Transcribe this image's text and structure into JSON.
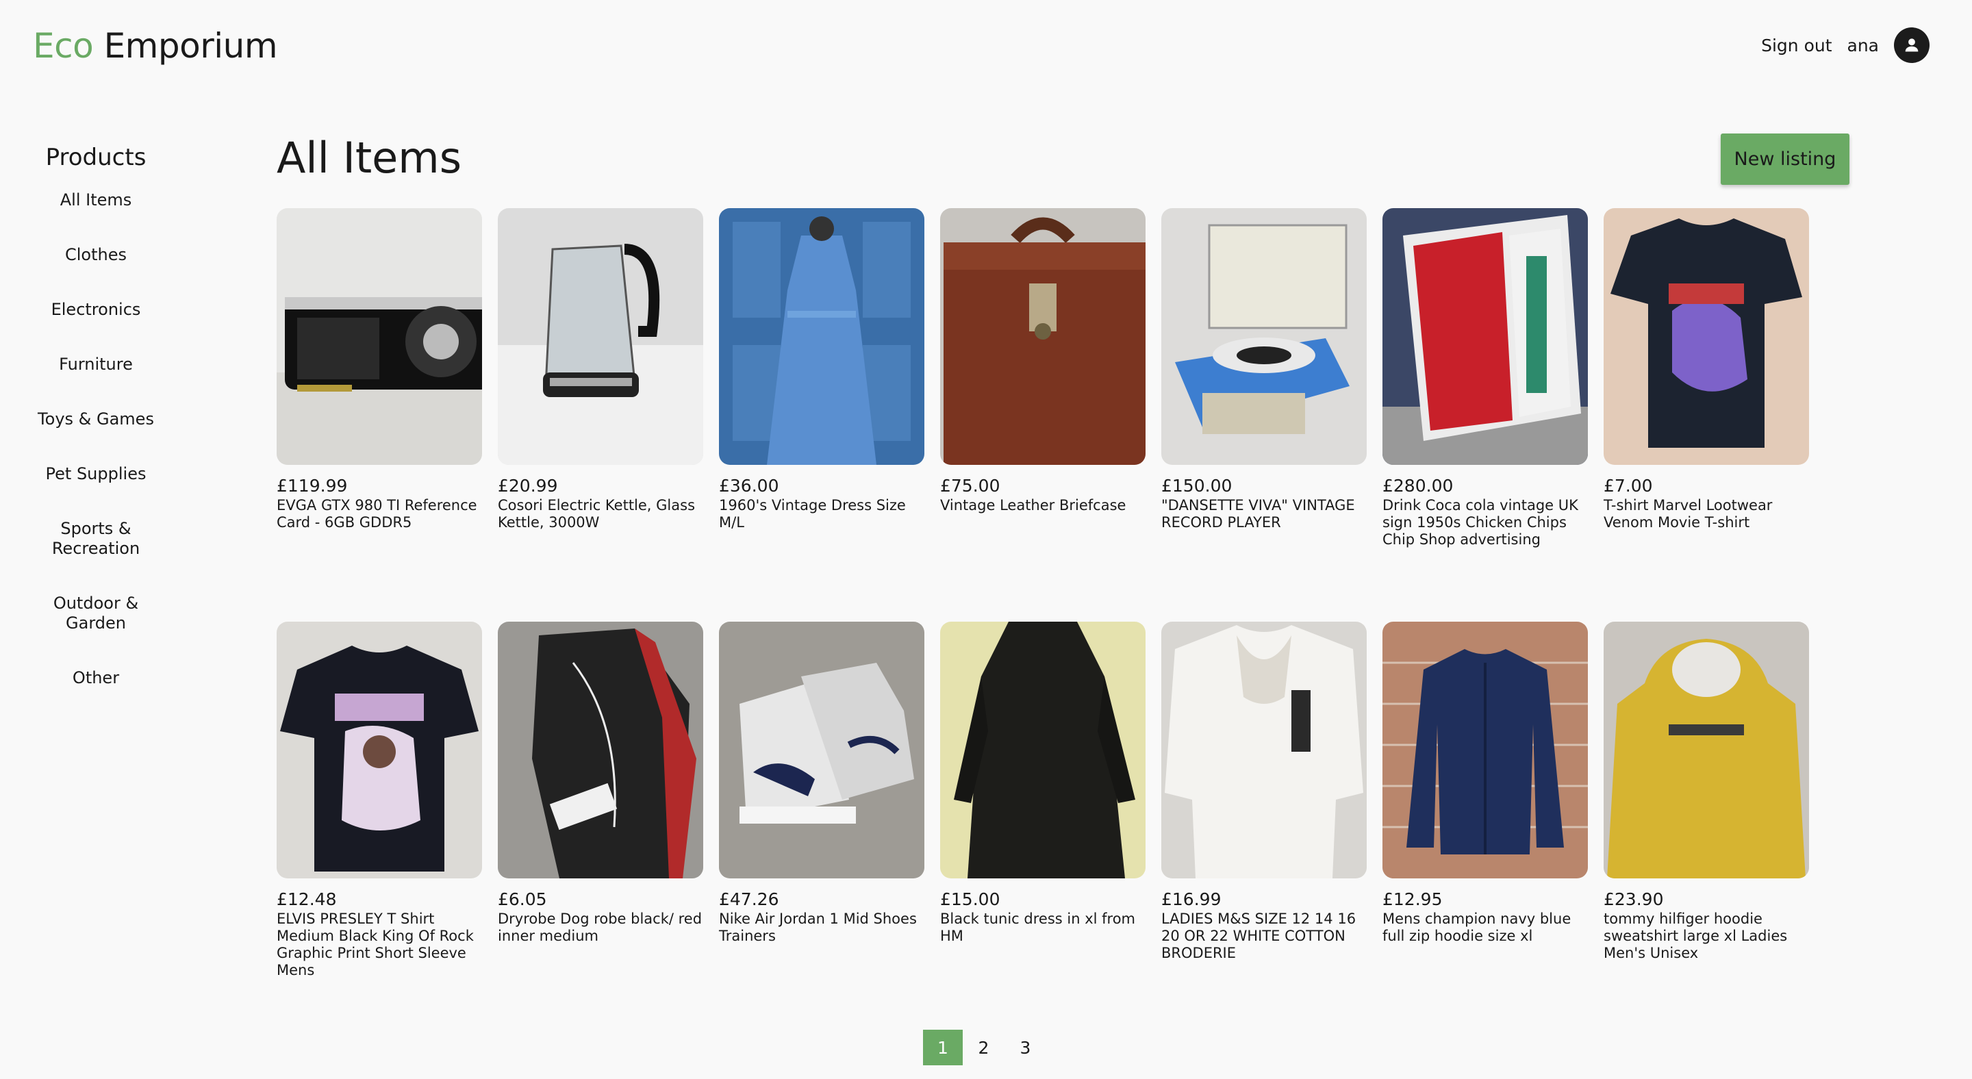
{
  "brand": {
    "part1": "Eco",
    "part2": "Emporium",
    "accent": "#6aaa64"
  },
  "header": {
    "signout": "Sign out",
    "username": "ana"
  },
  "sidebar": {
    "heading": "Products",
    "items": [
      {
        "label": "All Items"
      },
      {
        "label": "Clothes"
      },
      {
        "label": "Electronics"
      },
      {
        "label": "Furniture"
      },
      {
        "label": "Toys & Games"
      },
      {
        "label": "Pet Supplies"
      },
      {
        "label": "Sports & Recreation"
      },
      {
        "label": "Outdoor & Garden"
      },
      {
        "label": "Other"
      }
    ]
  },
  "main": {
    "title": "All Items",
    "new_listing": "New listing",
    "products": [
      {
        "price": "£119.99",
        "title": "EVGA GTX 980 TI Reference Card - 6GB GDDR5"
      },
      {
        "price": "£20.99",
        "title": "Cosori Electric Kettle, Glass Kettle, 3000W"
      },
      {
        "price": "£36.00",
        "title": "1960's Vintage Dress Size M/L"
      },
      {
        "price": "£75.00",
        "title": "Vintage Leather Briefcase"
      },
      {
        "price": "£150.00",
        "title": "\"DANSETTE VIVA\" VINTAGE RECORD PLAYER"
      },
      {
        "price": "£280.00",
        "title": "Drink Coca cola vintage UK sign 1950s Chicken Chips Chip Shop advertising"
      },
      {
        "price": "£7.00",
        "title": "T-shirt Marvel Lootwear Venom Movie T-shirt"
      },
      {
        "price": "£12.48",
        "title": "ELVIS PRESLEY T Shirt Medium Black King Of Rock Graphic Print Short Sleeve Mens"
      },
      {
        "price": "£6.05",
        "title": "Dryrobe Dog robe black/ red inner medium"
      },
      {
        "price": "£47.26",
        "title": "Nike Air Jordan 1 Mid Shoes Trainers"
      },
      {
        "price": "£15.00",
        "title": "Black tunic dress in xl from HM"
      },
      {
        "price": "£16.99",
        "title": "LADIES M&S SIZE 12 14 16 20 OR 22 WHITE COTTON BRODERIE"
      },
      {
        "price": "£12.95",
        "title": "Mens champion navy blue full zip hoodie size xl"
      },
      {
        "price": "£23.90",
        "title": "tommy hilfiger hoodie sweatshirt large xl Ladies Men's Unisex"
      }
    ]
  },
  "pagination": {
    "pages": [
      "1",
      "2",
      "3"
    ],
    "current": "1"
  }
}
